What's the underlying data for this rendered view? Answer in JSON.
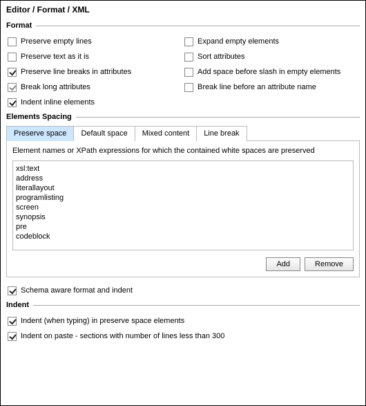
{
  "title": "Editor / Format / XML",
  "format": {
    "header": "Format",
    "left": [
      {
        "label": "Preserve empty lines",
        "checked": false
      },
      {
        "label": "Preserve text as it is",
        "checked": false
      },
      {
        "label": "Preserve line breaks in attributes",
        "checked": true
      },
      {
        "label": "Break long attributes",
        "checked": true,
        "gray": true
      },
      {
        "label": "Indent inline elements",
        "checked": true
      }
    ],
    "right": [
      {
        "label": "Expand empty elements",
        "checked": false
      },
      {
        "label": "Sort attributes",
        "checked": false
      },
      {
        "label": "Add space before slash in empty elements",
        "checked": false
      },
      {
        "label": "Break line before an attribute name",
        "checked": false
      }
    ]
  },
  "elements_spacing": {
    "header": "Elements Spacing",
    "tabs": [
      {
        "label": "Preserve space",
        "active": true
      },
      {
        "label": "Default space",
        "active": false
      },
      {
        "label": "Mixed content",
        "active": false
      },
      {
        "label": "Line break",
        "active": false
      }
    ],
    "description": "Element names or XPath expressions for which the contained white spaces are preserved",
    "list": [
      "xsl:text",
      "address",
      "literallayout",
      "programlisting",
      "screen",
      "synopsis",
      "pre",
      "codeblock"
    ],
    "add_label": "Add",
    "remove_label": "Remove",
    "schema_aware": {
      "label": "Schema aware format and indent",
      "checked": true
    }
  },
  "indent": {
    "header": "Indent",
    "items": [
      {
        "label": "Indent (when typing) in preserve space elements",
        "checked": true
      },
      {
        "label": "Indent on paste - sections with number of lines less than 300",
        "checked": true
      }
    ]
  }
}
